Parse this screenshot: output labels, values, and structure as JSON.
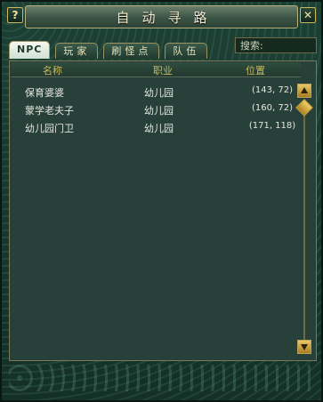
{
  "window": {
    "title": "自动寻路",
    "help_label": "?",
    "close_label": "✕"
  },
  "tabs": [
    {
      "label": "NPC",
      "active": true
    },
    {
      "label": "玩家",
      "active": false
    },
    {
      "label": "刷怪点",
      "active": false
    },
    {
      "label": "队伍",
      "active": false
    }
  ],
  "search": {
    "placeholder": "搜索:"
  },
  "table": {
    "headers": {
      "name": "名称",
      "job": "职业",
      "position": "位置"
    },
    "rows": [
      {
        "name": "保育婆婆",
        "job": "幼儿园",
        "position": "(143, 72)"
      },
      {
        "name": "蒙学老夫子",
        "job": "幼儿园",
        "position": "(160, 72)"
      },
      {
        "name": "幼儿园门卫",
        "job": "幼儿园",
        "position": "(171, 118)"
      }
    ]
  },
  "scrollbar": {
    "up_icon": "arrow-up-icon",
    "down_icon": "arrow-down-icon"
  },
  "colors": {
    "header_text": "#c9b95e",
    "row_text": "#e4e6de",
    "panel_bg": "#28403a"
  }
}
